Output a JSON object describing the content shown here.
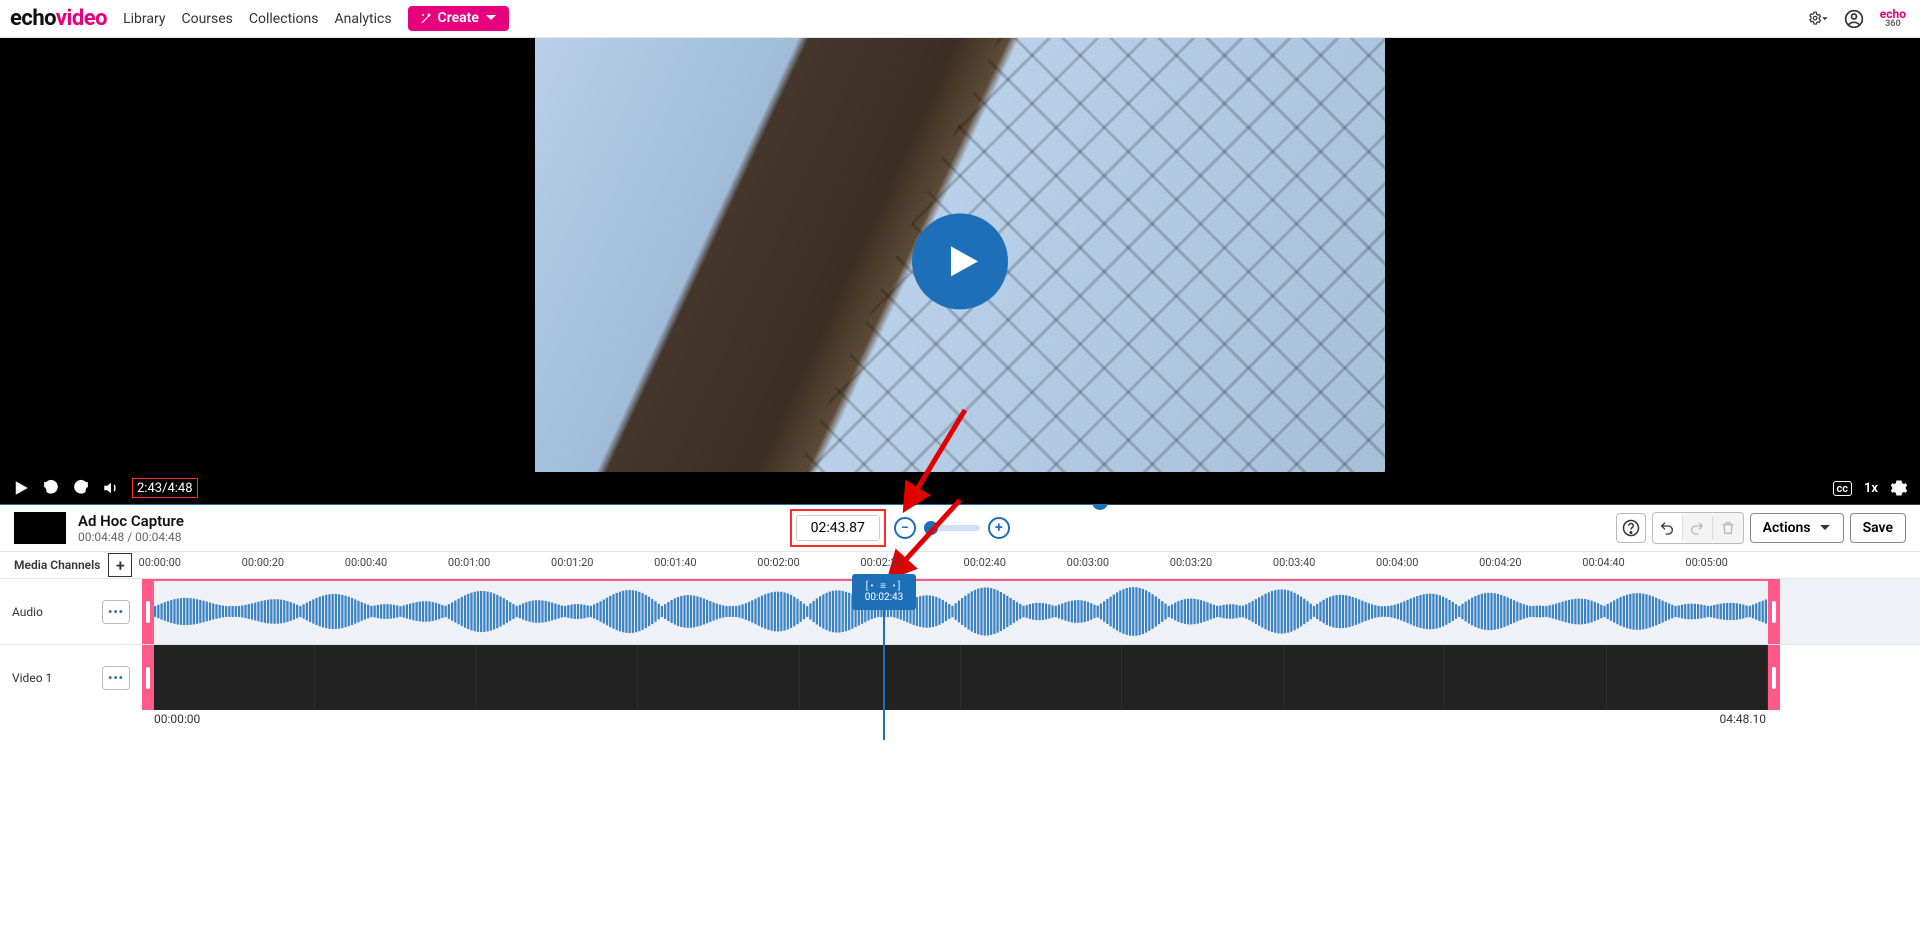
{
  "nav": {
    "logo_a": "echo",
    "logo_b": "video",
    "links": [
      "Library",
      "Courses",
      "Collections",
      "Analytics"
    ],
    "create": "Create",
    "echo360_a": "echo",
    "echo360_b": "360"
  },
  "player": {
    "current": "2:43",
    "sep": "/",
    "duration": "4:48",
    "speed": "1x",
    "cc": "cc"
  },
  "edit": {
    "title": "Ad Hoc Capture",
    "times": "00:04:48 / 00:04:48",
    "time_input": "02:43.87",
    "actions": "Actions",
    "save": "Save"
  },
  "timeline": {
    "media_channels": "Media Channels",
    "audio_label": "Audio",
    "video1_label": "Video 1",
    "ticks": [
      "00:00:00",
      "00:00:20",
      "00:00:40",
      "00:01:00",
      "00:01:20",
      "00:01:40",
      "00:02:00",
      "00:02:20",
      "00:02:40",
      "00:03:00",
      "00:03:20",
      "00:03:40",
      "00:04:00",
      "00:04:20",
      "00:04:40",
      "00:05:00"
    ],
    "tick_pct": [
      1.0,
      6.8,
      12.6,
      18.4,
      24.2,
      30.0,
      35.8,
      41.6,
      47.4,
      53.2,
      59.0,
      64.8,
      70.6,
      76.4,
      82.2,
      88.0
    ],
    "playhead_label": "00:02:43",
    "footer_left": "00:00:00",
    "footer_right": "04:48.10"
  }
}
